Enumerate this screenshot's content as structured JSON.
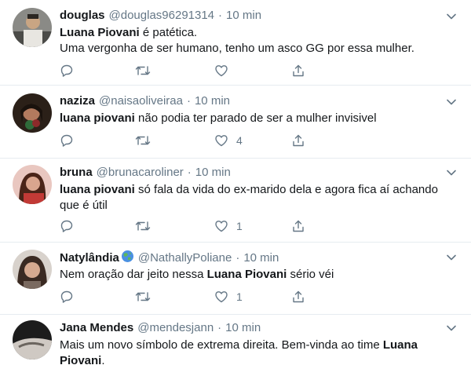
{
  "tweets": [
    {
      "name": "douglas",
      "handle": "@douglas96291314",
      "time": "10 min",
      "line1_bold": "Luana Piovani",
      "line1_rest": " é patética.",
      "line2": "Uma vergonha de ser humano, tenho um asco GG por essa mulher.",
      "likes": ""
    },
    {
      "name": "naziza",
      "handle": "@naisaoliveiraa",
      "time": "10 min",
      "line1_bold": "luana piovani",
      "line1_rest": " não podia ter parado de ser a mulher invisivel",
      "likes": "4"
    },
    {
      "name": "bruna",
      "handle": "@brunacaroliner",
      "time": "10 min",
      "line1_bold": "luana piovani",
      "line1_rest": " só fala da vida do ex-marido dela e agora fica aí achando",
      "line2": "que é útil",
      "likes": "1"
    },
    {
      "name": "Natylândia",
      "handle": "@NathallyPoliane",
      "time": "10 min",
      "line1_pre": "Nem oração dar jeito nessa ",
      "line1_bold": "Luana Piovani",
      "line1_rest": " sério véi",
      "likes": "1"
    },
    {
      "name": "Jana Mendes",
      "handle": "@mendesjann",
      "time": "10 min",
      "line1_pre": "Mais um novo símbolo de extrema direita. Bem-vinda ao time ",
      "line1_bold": "Luana",
      "line2_bold": "Piovani",
      "line2_rest": "."
    }
  ],
  "separator": "·",
  "icons": {
    "reply": "reply-icon",
    "retweet": "retweet-icon",
    "like": "heart-icon",
    "share": "share-icon",
    "menu": "chevron-down-icon"
  },
  "colors": {
    "text": "#14171a",
    "muted": "#657786",
    "border": "#e6ecf0"
  }
}
